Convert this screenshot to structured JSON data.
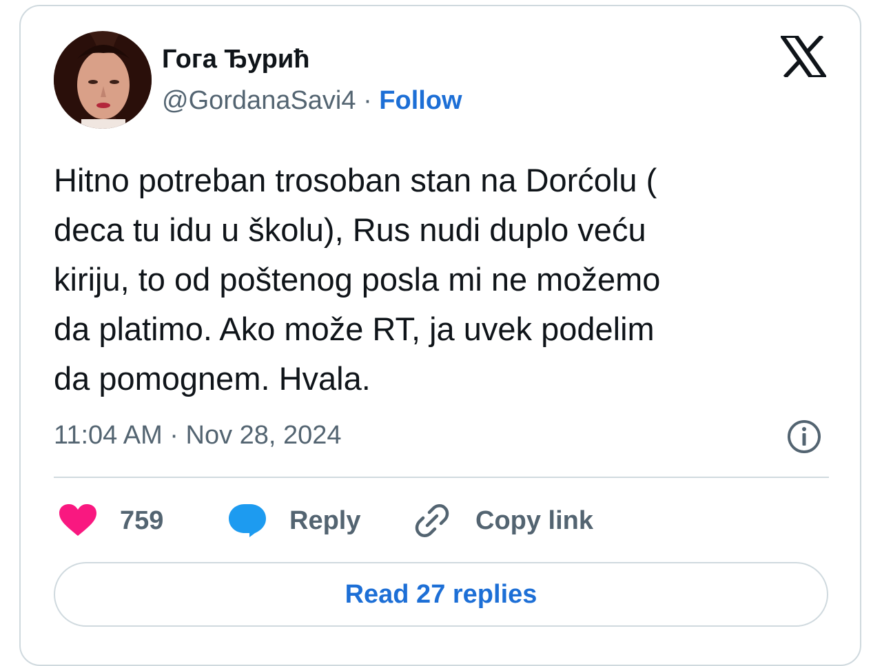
{
  "author": {
    "display_name": "Гога Ђурић",
    "handle": "@GordanaSavi4",
    "separator": "·",
    "follow_label": "Follow"
  },
  "tweet": {
    "lines": [
      "Hitno potreban trosoban stan na Dorćolu (",
      "deca tu idu u školu), Rus nudi duplo veću",
      "kiriju, to od poštenog posla mi ne možemo",
      "da platimo. Ako može RT, ja uvek podelim",
      "da pomognem. Hvala."
    ],
    "timestamp": "11:04 AM · Nov 28, 2024"
  },
  "actions": {
    "like_count": "759",
    "reply_label": "Reply",
    "copy_link_label": "Copy link"
  },
  "read_replies_label": "Read 27 replies",
  "icons": {
    "brand": "x-logo-icon",
    "info": "info-icon",
    "like": "heart-icon",
    "reply": "speech-bubble-icon",
    "copy": "link-icon"
  },
  "colors": {
    "text": "#0f1419",
    "secondary": "#536471",
    "link": "#1d6fd6",
    "like": "#f91880",
    "reply": "#1d9bf0",
    "border": "#cfd9de"
  }
}
